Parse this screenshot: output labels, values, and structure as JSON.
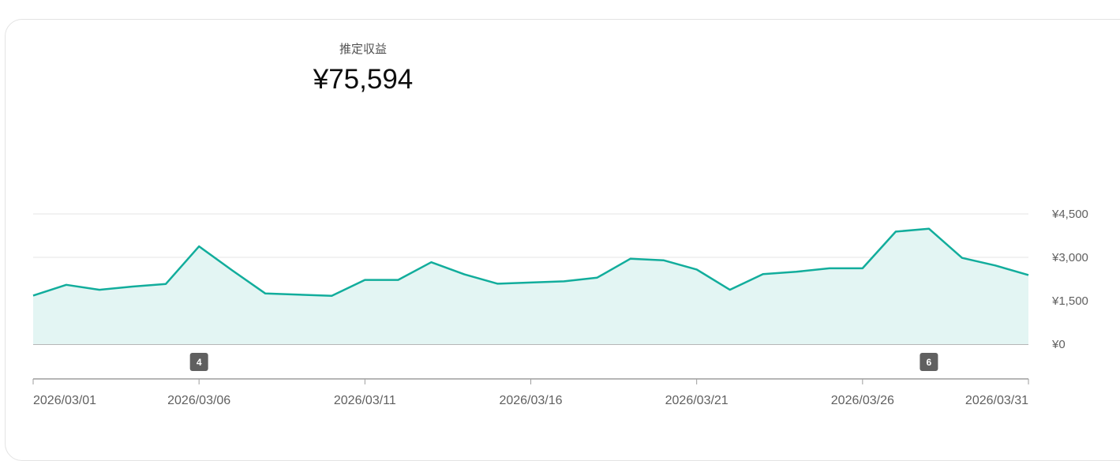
{
  "header": {
    "metric_label": "推定収益",
    "metric_value": "¥75,594"
  },
  "colors": {
    "line": "#12ad9c",
    "area": "#e3f5f3",
    "grid": "#e6e6e6",
    "baseline": "#9e9e9e",
    "marker_bg": "#606060"
  },
  "markers": [
    {
      "date": "2026/03/06",
      "label": "4"
    },
    {
      "date": "2026/03/28",
      "label": "6"
    }
  ],
  "chart_data": {
    "type": "area",
    "x_tick_labels": [
      "2026/03/01",
      "2026/03/06",
      "2026/03/11",
      "2026/03/16",
      "2026/03/21",
      "2026/03/26",
      "2026/03/31"
    ],
    "y_tick_labels": [
      "¥4,500",
      "¥3,000",
      "¥1,500",
      "¥0"
    ],
    "y_ticks": [
      4500,
      3000,
      1500,
      0
    ],
    "ylim": [
      0,
      4500
    ],
    "y_axis_position": "right",
    "grid": true,
    "x": [
      "2026/03/01",
      "2026/03/02",
      "2026/03/03",
      "2026/03/04",
      "2026/03/05",
      "2026/03/06",
      "2026/03/07",
      "2026/03/08",
      "2026/03/09",
      "2026/03/10",
      "2026/03/11",
      "2026/03/12",
      "2026/03/13",
      "2026/03/14",
      "2026/03/15",
      "2026/03/16",
      "2026/03/17",
      "2026/03/18",
      "2026/03/19",
      "2026/03/20",
      "2026/03/21",
      "2026/03/22",
      "2026/03/23",
      "2026/03/24",
      "2026/03/25",
      "2026/03/26",
      "2026/03/27",
      "2026/03/28",
      "2026/03/29",
      "2026/03/30",
      "2026/03/31"
    ],
    "values": [
      1680,
      2050,
      1880,
      1990,
      2080,
      3380,
      2550,
      1750,
      1710,
      1670,
      2220,
      2220,
      2830,
      2410,
      2090,
      2130,
      2170,
      2300,
      2950,
      2900,
      2580,
      1880,
      2420,
      2500,
      2620,
      2620,
      3890,
      3990,
      2980,
      2720,
      2390
    ]
  }
}
